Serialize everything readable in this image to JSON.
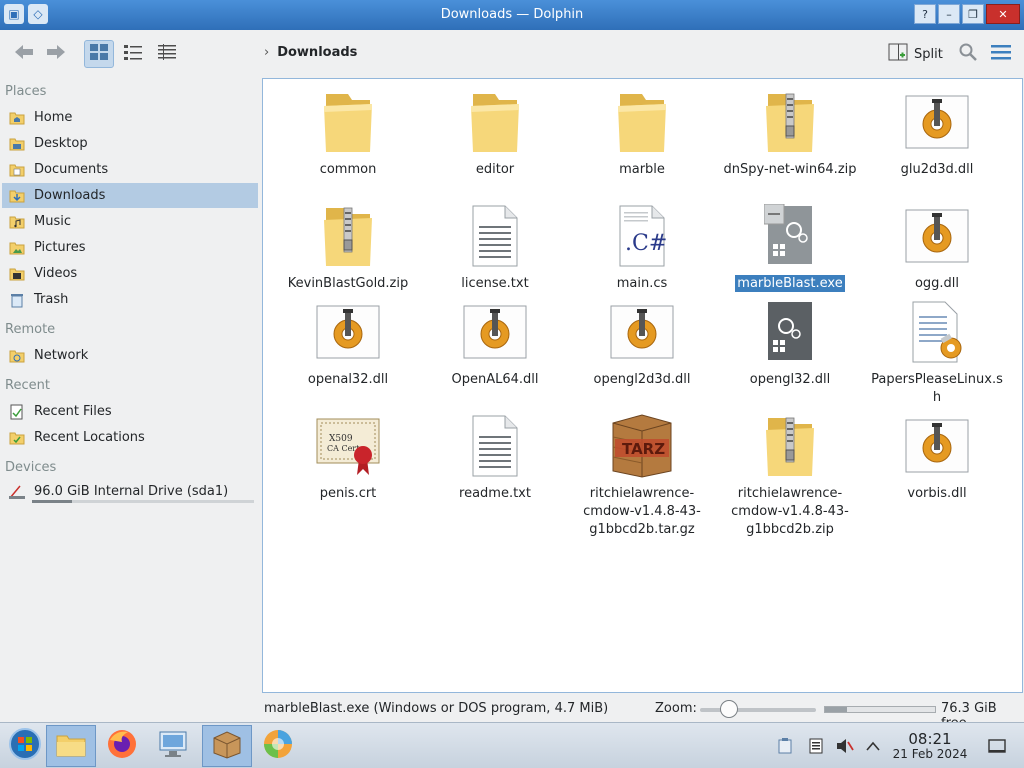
{
  "window": {
    "title": "Downloads — Dolphin"
  },
  "toolbar": {
    "location": "Downloads",
    "split_label": "Split"
  },
  "sidebar": {
    "sections": {
      "places": "Places",
      "remote": "Remote",
      "recent": "Recent",
      "devices": "Devices"
    },
    "places": [
      {
        "label": "Home",
        "icon": "home-folder-icon"
      },
      {
        "label": "Desktop",
        "icon": "desktop-folder-icon"
      },
      {
        "label": "Documents",
        "icon": "documents-folder-icon"
      },
      {
        "label": "Downloads",
        "icon": "downloads-folder-icon",
        "active": true
      },
      {
        "label": "Music",
        "icon": "music-folder-icon"
      },
      {
        "label": "Pictures",
        "icon": "pictures-folder-icon"
      },
      {
        "label": "Videos",
        "icon": "videos-folder-icon"
      },
      {
        "label": "Trash",
        "icon": "trash-icon"
      }
    ],
    "remote": [
      {
        "label": "Network",
        "icon": "network-folder-icon"
      }
    ],
    "recent": [
      {
        "label": "Recent Files",
        "icon": "recent-files-icon"
      },
      {
        "label": "Recent Locations",
        "icon": "recent-locations-icon"
      }
    ],
    "devices": [
      {
        "label": "96.0 GiB Internal Drive (sda1)",
        "icon": "hard-drive-icon",
        "used_fraction": 0.18
      }
    ]
  },
  "files": [
    {
      "name": "common",
      "type": "folder"
    },
    {
      "name": "editor",
      "type": "folder"
    },
    {
      "name": "marble",
      "type": "folder"
    },
    {
      "name": "dnSpy-net-win64.zip",
      "type": "zip"
    },
    {
      "name": "glu2d3d.dll",
      "type": "dll"
    },
    {
      "name": "KevinBlastGold.zip",
      "type": "zip"
    },
    {
      "name": "license.txt",
      "type": "text"
    },
    {
      "name": "main.cs",
      "type": "csharp"
    },
    {
      "name": "marbleBlast.exe",
      "type": "exe",
      "selected": true
    },
    {
      "name": "ogg.dll",
      "type": "dll"
    },
    {
      "name": "openal32.dll",
      "type": "dll"
    },
    {
      "name": "OpenAL64.dll",
      "type": "dll"
    },
    {
      "name": "opengl2d3d.dll",
      "type": "dll"
    },
    {
      "name": "opengl32.dll",
      "type": "exe-dark"
    },
    {
      "name": "PapersPleaseLinux.sh",
      "type": "script"
    },
    {
      "name": "penis.crt",
      "type": "certificate"
    },
    {
      "name": "readme.txt",
      "type": "text"
    },
    {
      "name": "ritchielawrence-cmdow-v1.4.8-43-g1bbcd2b.tar.gz",
      "type": "tarball"
    },
    {
      "name": "ritchielawrence-cmdow-v1.4.8-43-g1bbcd2b.zip",
      "type": "zip"
    },
    {
      "name": "vorbis.dll",
      "type": "dll"
    }
  ],
  "statusbar": {
    "info": "marbleBlast.exe (Windows or DOS program, 4.7 MiB)",
    "zoom_label": "Zoom:",
    "zoom_level": 0.25,
    "free_space": "76.3 GiB free",
    "free_fraction": 0.2
  },
  "taskbar": {
    "apps": [
      {
        "name": "start-button",
        "icon": "windows-orb-icon"
      },
      {
        "name": "taskbar-file-manager",
        "icon": "folder-icon",
        "active": true
      },
      {
        "name": "taskbar-firefox",
        "icon": "firefox-icon"
      },
      {
        "name": "taskbar-system-settings",
        "icon": "computer-settings-icon"
      },
      {
        "name": "taskbar-archiver",
        "icon": "package-icon",
        "active": true
      },
      {
        "name": "taskbar-wine",
        "icon": "wine-glass-icon"
      }
    ],
    "clock_time": "08:21",
    "clock_date": "21 Feb 2024"
  },
  "colors": {
    "accent": "#3c7fbe",
    "selection": "#b3cbe3",
    "titlebar": "#2f6fb8",
    "folder": "#f3cf6a"
  }
}
